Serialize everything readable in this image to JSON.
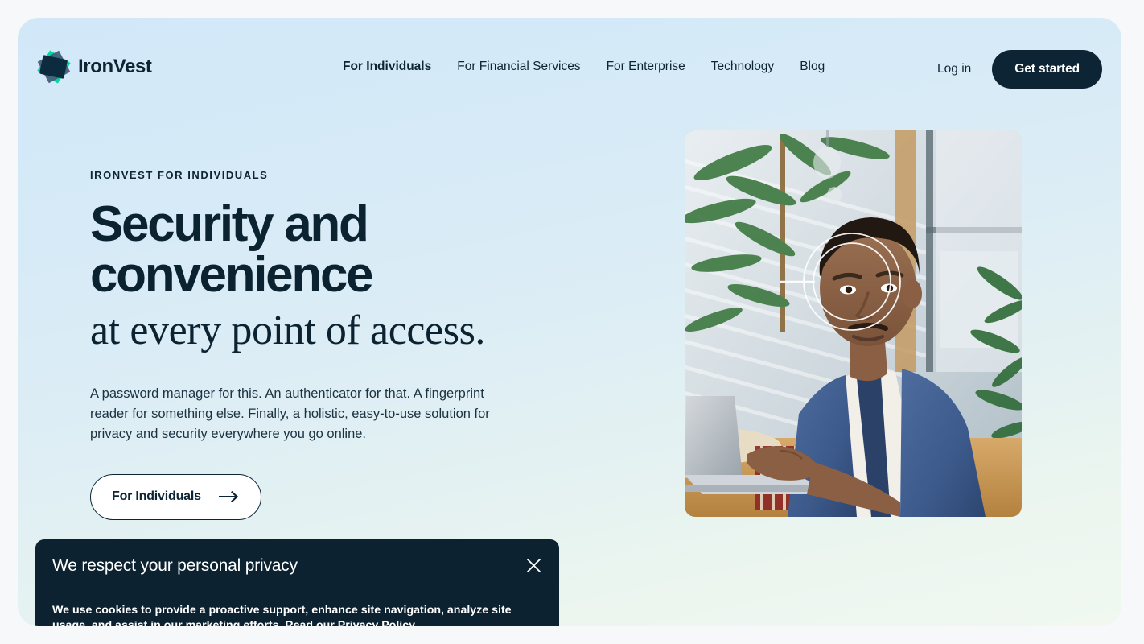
{
  "brand": {
    "name": "IronVest",
    "logo_icon": "ironvest-diamond-logo",
    "colors": {
      "teal": "#00d9a3",
      "slate": "#44617a",
      "navy": "#0c2b3e"
    }
  },
  "nav": {
    "items": [
      {
        "label": "For Individuals",
        "active": true
      },
      {
        "label": "For Financial Services",
        "active": false
      },
      {
        "label": "For Enterprise",
        "active": false
      },
      {
        "label": "Technology",
        "active": false
      },
      {
        "label": "Blog",
        "active": false
      }
    ],
    "login_label": "Log in",
    "cta_label": "Get started"
  },
  "hero": {
    "eyebrow": "IRONVEST FOR INDIVIDUALS",
    "title_bold_line1": "Security and",
    "title_bold_line2": "convenience",
    "title_serif_line": "at every point of access.",
    "description": "A password manager for this. An authenticator for that. A fingerprint reader for something else. Finally, a holistic, easy-to-use solution for privacy and security everywhere you go online.",
    "cta_label": "For Individuals",
    "cta_icon": "arrow-right-icon",
    "image_alt": "Man working on a laptop with facial recognition scan overlay"
  },
  "cookie_banner": {
    "title": "We respect your personal privacy",
    "body_before_link": "We use cookies to provide a proactive support, enhance site navigation, analyze site usage, and assist in our marketing efforts. Read our ",
    "link_label": "Privacy Policy",
    "close_icon": "close-icon",
    "background_color": "#0c2230"
  },
  "theme": {
    "page_background": "#f7f8fa",
    "hero_gradient_start": "#d2e8f8",
    "hero_gradient_end": "#f0f8f0",
    "ink": "#0c2433"
  }
}
